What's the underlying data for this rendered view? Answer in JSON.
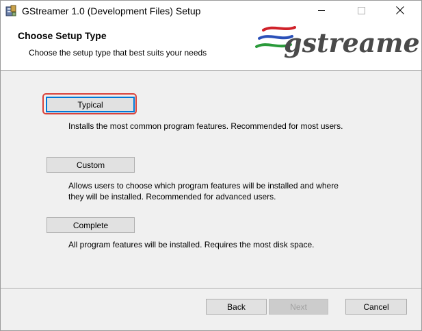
{
  "window": {
    "title": "GStreamer 1.0 (Development Files) Setup"
  },
  "titlebar_buttons": {
    "minimize_icon": "minimize-icon",
    "maximize_icon": "maximize-icon",
    "close_icon": "close-icon"
  },
  "banner": {
    "title": "Choose Setup Type",
    "subtitle": "Choose the setup type that best suits your needs",
    "logo_text": "gstreamer",
    "logo_colors": [
      "#d0222a",
      "#2a50b8",
      "#2a9a3a"
    ]
  },
  "options": [
    {
      "label": "Typical",
      "description": "Installs the most common program features. Recommended for most users."
    },
    {
      "label": "Custom",
      "description_line1": "Allows users to choose which program features will be installed and where",
      "description_line2": "they will be installed. Recommended for advanced users."
    },
    {
      "label": "Complete",
      "description": "All program features will be installed. Requires the most disk space."
    }
  ],
  "footer": {
    "back_label": "Back",
    "next_label": "Next",
    "cancel_label": "Cancel"
  },
  "colors": {
    "focus_accent": "#0078d7",
    "highlight_outline": "#d9423a"
  }
}
